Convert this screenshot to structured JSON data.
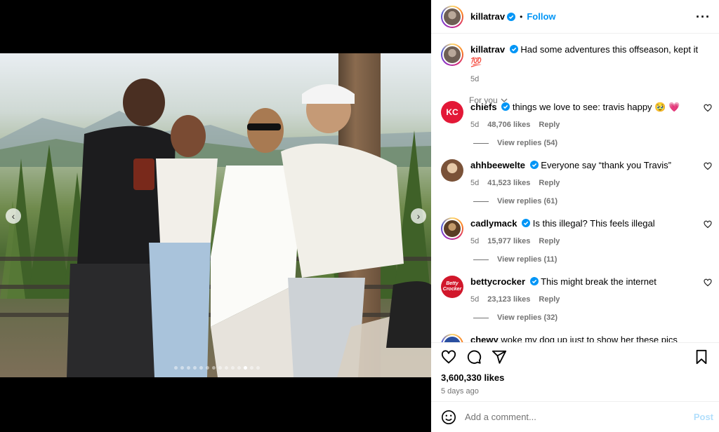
{
  "post": {
    "username": "killatrav",
    "follow_label": "Follow",
    "more_icon": "more-horizontal-icon",
    "caption_text": "Had some adventures this offseason, kept it 💯",
    "caption_time": "5d",
    "for_you_label": "For you",
    "likes": "3,600,330 likes",
    "posted_ago": "5 days ago",
    "carousel_dots": 14,
    "carousel_active_index": 11
  },
  "comments": [
    {
      "user": "chiefs",
      "text": "things we love to see: travis happy 🥹 💗",
      "time": "5d",
      "likes": "48,706 likes",
      "reply": "Reply",
      "view_replies": "View replies (54)"
    },
    {
      "user": "ahhbeewelte",
      "text": "Everyone say “thank you Travis”",
      "time": "5d",
      "likes": "41,523 likes",
      "reply": "Reply",
      "view_replies": "View replies (61)"
    },
    {
      "user": "cadlymack",
      "text": "Is this illegal? This feels illegal",
      "time": "5d",
      "likes": "15,977 likes",
      "reply": "Reply",
      "view_replies": "View replies (11)"
    },
    {
      "user": "bettycrocker",
      "text": "This might break the internet",
      "time": "5d",
      "likes": "23,123 likes",
      "reply": "Reply",
      "view_replies": "View replies (32)"
    },
    {
      "user": "chewy",
      "text": "woke my dog up just to show her these pics"
    }
  ],
  "avatars": {
    "chiefs": "KC",
    "betty": "Betty Crocker"
  },
  "composer": {
    "placeholder": "Add a comment...",
    "post_label": "Post"
  },
  "colors": {
    "accent": "#0095f6",
    "post_disabled": "#b2dffc",
    "chiefs_red": "#e31837"
  }
}
